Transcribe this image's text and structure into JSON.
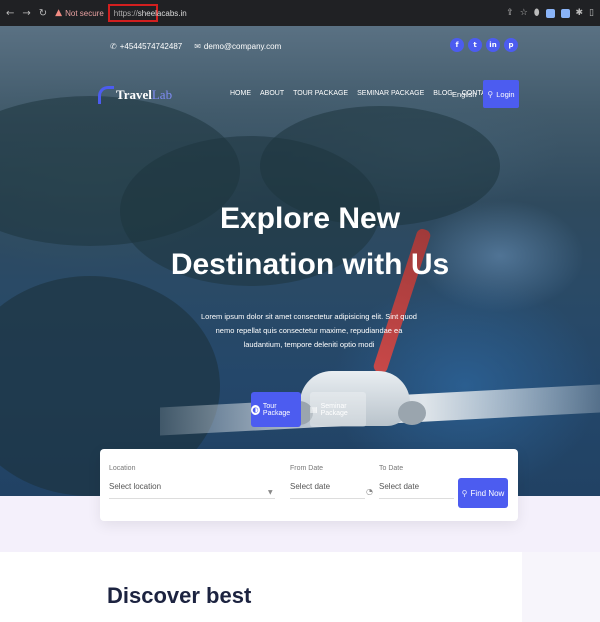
{
  "browser": {
    "not_secure": "Not secure",
    "url_scheme": "https://",
    "url_host": "sheelacabs.in"
  },
  "topbar": {
    "phone": "+4544574742487",
    "email": "demo@company.com",
    "socials": [
      "f",
      "t",
      "in",
      "p"
    ]
  },
  "navbar": {
    "logo_part1": "Travel",
    "logo_part2": "Lab",
    "menu": [
      "HOME",
      "ABOUT",
      "TOUR PACKAGE",
      "SEMINAR PACKAGE",
      "BLOG",
      "CONTACT"
    ],
    "language": "English",
    "login": "Login"
  },
  "hero": {
    "title_line1": "Explore New",
    "title_line2": "Destination with Us",
    "subtitle": "Lorem ipsum dolor sit amet consectetur adipisicing elit. Sint quod nemo repellat quis consectetur maxime, repudiandae ea laudantium, tempore deleniti optio modi",
    "btn_tour": "Tour Package",
    "btn_seminar": "Seminar Package"
  },
  "search": {
    "location_label": "Location",
    "location_value": "Select location",
    "from_label": "From Date",
    "from_placeholder": "Select date",
    "to_label": "To Date",
    "to_placeholder": "Select date",
    "find_label": "Find Now"
  },
  "section": {
    "heading": "Discover best"
  },
  "colors": {
    "accent": "#4c5cf0",
    "dark_text": "#1c2340"
  }
}
